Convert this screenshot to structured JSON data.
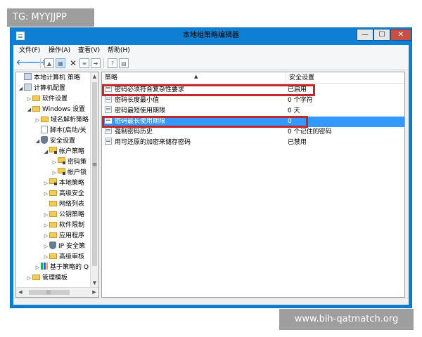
{
  "watermarks": {
    "top": "TG: MYYJJPP",
    "bottom": "www.bih-qatmatch.org"
  },
  "window": {
    "title": "本地组策略编辑器",
    "minimize": "—",
    "maximize": "☐",
    "close": "✕"
  },
  "menu": [
    "文件(F)",
    "操作(A)",
    "查看(V)",
    "帮助(H)"
  ],
  "toolbar": [
    "back-arrow",
    "forward-arrow",
    "up-folder",
    "show-hide-tree",
    "delete",
    "properties",
    "export-list",
    "help",
    "extended-view"
  ],
  "tree": {
    "items": [
      {
        "label": "本地计算机 策略",
        "twisty": "",
        "icon": "computer"
      },
      {
        "label": "计算机配置",
        "twisty": "◢",
        "icon": "computer"
      },
      {
        "label": "软件设置",
        "twisty": "▷",
        "icon": "folder"
      },
      {
        "label": "Windows 设置",
        "twisty": "◢",
        "icon": "folder"
      },
      {
        "label": "域名解析策略",
        "twisty": "▷",
        "icon": "folder"
      },
      {
        "label": "脚本(启动/关",
        "twisty": "",
        "icon": "doc"
      },
      {
        "label": "安全设置",
        "twisty": "◢",
        "icon": "shield"
      },
      {
        "label": "帐户策略",
        "twisty": "◢",
        "icon": "folder-lock"
      },
      {
        "label": "密码策",
        "twisty": "▷",
        "icon": "folder-lock"
      },
      {
        "label": "帐户锁",
        "twisty": "▷",
        "icon": "folder-lock"
      },
      {
        "label": "本地策略",
        "twisty": "▷",
        "icon": "folder-lock"
      },
      {
        "label": "高级安全",
        "twisty": "▷",
        "icon": "folder"
      },
      {
        "label": "网络列表",
        "twisty": "",
        "icon": "folder"
      },
      {
        "label": "公钥策略",
        "twisty": "▷",
        "icon": "folder"
      },
      {
        "label": "软件限制",
        "twisty": "▷",
        "icon": "folder"
      },
      {
        "label": "应用程序",
        "twisty": "▷",
        "icon": "folder"
      },
      {
        "label": "IP 安全策",
        "twisty": "▷",
        "icon": "shield"
      },
      {
        "label": "高级审核",
        "twisty": "▷",
        "icon": "folder"
      },
      {
        "label": "基于策略的 Q",
        "twisty": "▷",
        "icon": "chart"
      },
      {
        "label": "管理模板",
        "twisty": "▷",
        "icon": "folder"
      }
    ],
    "scroll": {
      "up": "▲",
      "down": "▼",
      "left": "◀",
      "right": "▶",
      "grip": "≡",
      "hgrip": "|||"
    }
  },
  "list": {
    "columns": {
      "policy": "策略",
      "setting": "安全设置"
    },
    "rows": [
      {
        "name": "密码必须符合复杂性要求",
        "value": "已启用"
      },
      {
        "name": "密码长度最小值",
        "value": "0 个字符"
      },
      {
        "name": "密码最短使用期限",
        "value": "0 天"
      },
      {
        "name": "密码最长使用期限",
        "value": "0"
      },
      {
        "name": "强制密码历史",
        "value": "0 个记住的密码"
      },
      {
        "name": "用可还原的加密来储存密码",
        "value": "已禁用"
      }
    ]
  },
  "colors": {
    "titlebar": "#0f7fd3",
    "selection": "#3399ff",
    "highlight": "#c4262e",
    "close": "#c74f43"
  }
}
